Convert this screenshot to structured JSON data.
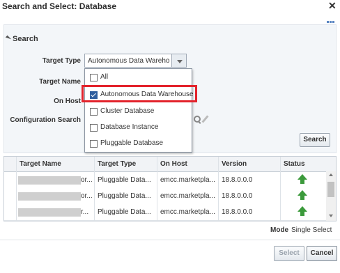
{
  "dialog": {
    "title": "Search and Select: Database",
    "close_icon": "close-icon"
  },
  "search": {
    "header": "Search",
    "target_type_label": "Target Type",
    "target_type_value": "Autonomous Data Warehouse",
    "target_name_label": "Target Name",
    "on_host_label": "On Host",
    "config_search_label": "Configuration Search",
    "search_button": "Search"
  },
  "dropdown": {
    "options": [
      {
        "label": "All",
        "checked": false
      },
      {
        "label": "Autonomous Data Warehouse",
        "checked": true
      },
      {
        "label": "Cluster Database",
        "checked": false
      },
      {
        "label": "Database Instance",
        "checked": false
      },
      {
        "label": "Pluggable Database",
        "checked": false
      }
    ]
  },
  "table": {
    "columns": [
      "Target Name",
      "Target Type",
      "On Host",
      "Version",
      "Status"
    ],
    "rows": [
      {
        "name_suffix": "or...",
        "type": "Pluggable Data...",
        "host": "emcc.marketpla...",
        "version": "18.8.0.0.0",
        "status": "up-arrow-icon"
      },
      {
        "name_suffix": "or...",
        "type": "Pluggable Data...",
        "host": "emcc.marketpla...",
        "version": "18.8.0.0.0",
        "status": "up-arrow-icon"
      },
      {
        "name_suffix": "r...",
        "type": "Pluggable Data...",
        "host": "emcc.marketpla...",
        "version": "18.8.0.0.0",
        "status": "up-arrow-icon"
      }
    ]
  },
  "footer": {
    "mode_label": "Mode",
    "mode_value": "Single Select",
    "select_button": "Select",
    "cancel_button": "Cancel"
  },
  "colors": {
    "highlight": "#e3232c",
    "status_up": "#3b9a3b",
    "checkbox_checked": "#2f5e9e"
  }
}
